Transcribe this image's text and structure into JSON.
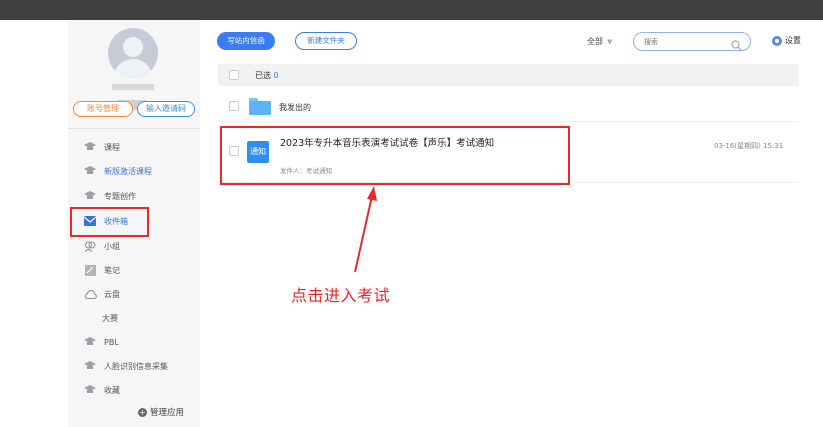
{
  "sidebar": {
    "btn_account": "账号管理",
    "btn_invite": "输入邀请码",
    "items": [
      {
        "label": "课程",
        "icon": "hat-icon"
      },
      {
        "label": "新版激活课程",
        "icon": "hat-icon"
      },
      {
        "label": "专题创作",
        "icon": "hat-icon"
      },
      {
        "label": "收件箱",
        "icon": "envelope-icon"
      },
      {
        "label": "小组",
        "icon": "group-icon"
      },
      {
        "label": "笔记",
        "icon": "note-icon"
      },
      {
        "label": "云盘",
        "icon": "cloud-icon"
      },
      {
        "label": "大赛",
        "icon": ""
      },
      {
        "label": "PBL",
        "icon": "hat-icon"
      },
      {
        "label": "人脸识别信息采集",
        "icon": "hat-icon"
      },
      {
        "label": "收藏",
        "icon": "hat-icon"
      }
    ],
    "manage_label": "管理应用"
  },
  "toolbar": {
    "write_label": "写站内信函",
    "new_folder_label": "新建文件夹",
    "filter_label": "全部",
    "search_placeholder": "搜索",
    "settings_label": "设置"
  },
  "list": {
    "selected_label": "已选",
    "selected_count": "0",
    "sent_folder_label": "我发出的",
    "message": {
      "tag": "通知",
      "title": "2023年专升本音乐表演考试试卷【声乐】考试通知",
      "sender": "发件人：考试通知",
      "time": "03-16(星期四) 15:31"
    }
  },
  "annotation": {
    "text": "点击进入考试"
  },
  "colors": {
    "accent": "#3a7cf4",
    "highlight": "#e52a2a",
    "topbar": "#3f3f3f"
  }
}
